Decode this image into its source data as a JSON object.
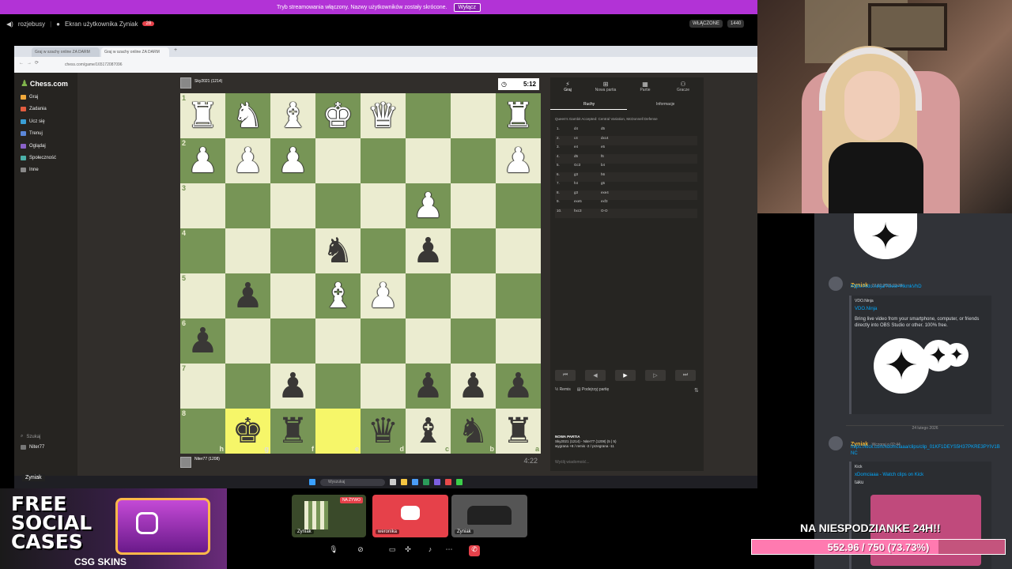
{
  "banner": {
    "text": "Tryb streamowania włączony. Nazwy użytkowników zostały skrócone.",
    "button": "Wyłącz"
  },
  "discord_header": {
    "channel": "rozjebusy",
    "screen_label": "Ekran użytkownika Zyniak",
    "live_badge": "WŁĄCZONE",
    "viewers": "1440"
  },
  "browser": {
    "tabs": [
      "Graj w szachy online ZA DARM",
      "Graj w szachy online ZA DARM"
    ],
    "url": "chess.com/game/165172087096"
  },
  "chess_sidebar": {
    "logo": "Chess.com",
    "items": [
      "Graj",
      "Zadania",
      "Ucz się",
      "Trenuj",
      "Oglądaj",
      "Społeczność",
      "Inne"
    ],
    "search": "Szukaj",
    "user": "Niter77"
  },
  "players": {
    "top": {
      "name": "Sky2021 (1214)",
      "clock": "5:12"
    },
    "bottom": {
      "name": "Niter77 (1208)",
      "clock": "4:22"
    }
  },
  "board": {
    "ranks": [
      "1",
      "2",
      "3",
      "4",
      "5",
      "6",
      "7",
      "8"
    ],
    "files": [
      "h",
      "g",
      "f",
      "e",
      "d",
      "c",
      "b",
      "a"
    ],
    "pieces": [
      [
        "wR",
        "wN",
        "wB",
        "wK",
        "wQ",
        "",
        "",
        "wR"
      ],
      [
        "wP",
        "wP",
        "wP",
        "",
        "",
        "",
        "",
        "wP"
      ],
      [
        "",
        "",
        "",
        "",
        "",
        "wP",
        "",
        ""
      ],
      [
        "",
        "",
        "",
        "bN",
        "",
        "bP",
        "",
        ""
      ],
      [
        "",
        "bP",
        "",
        "wB",
        "wP",
        "",
        "",
        ""
      ],
      [
        "bP",
        "",
        "",
        "",
        "",
        "",
        "",
        ""
      ],
      [
        "",
        "",
        "bP",
        "",
        "",
        "bP",
        "bP",
        "bP"
      ],
      [
        "",
        "bK",
        "bR",
        "",
        "bQ",
        "bB",
        "bN",
        "bR"
      ]
    ],
    "highlights": [
      [
        7,
        1
      ],
      [
        7,
        3
      ]
    ]
  },
  "right_panel": {
    "tabs": [
      "Graj",
      "Nowa partia",
      "Partie",
      "Gracze"
    ],
    "subtabs": [
      "Ruchy",
      "Informacje"
    ],
    "opening": "Queen's Gambit Accepted: Central Variation, McDonnell Defense",
    "moves": [
      [
        "1.",
        "d4",
        "d5"
      ],
      [
        "2.",
        "c4",
        "dxc4"
      ],
      [
        "3.",
        "e4",
        "e5"
      ],
      [
        "4.",
        "d5",
        "f6"
      ],
      [
        "5.",
        "Gc3",
        "b4"
      ],
      [
        "6.",
        "g3",
        "h6"
      ],
      [
        "7.",
        "h4",
        "g5"
      ],
      [
        "8.",
        "g3",
        "exe4"
      ],
      [
        "9.",
        "exe5",
        "exf3"
      ],
      [
        "10.",
        "hxc3",
        "O-O"
      ]
    ],
    "actions": [
      "Remis",
      "Podejrzyj partię"
    ],
    "new_game_title": "NOWA PARTIA",
    "new_game_line1": "Sky2021 (1214) - Niter77 (1208) (5 | 5)",
    "new_game_line2": "wygrana +8 / remis -2 / przegrana -11",
    "chat_placeholder": "Wyślij wiadomość..."
  },
  "taskbar": {
    "search": "Wyszukaj",
    "time": "00:00"
  },
  "chat": {
    "msg1": {
      "user": "Zyniak",
      "time": "22.02.2026 23:38",
      "link": "https://vdo.ninja/?view=HkmkVhD",
      "embed_site": "VDO.Ninja",
      "embed_title": "VDO.Ninja",
      "embed_desc": "Bring live video from your smartphone, computer, or friends directly into OBS Studio or other. 100% free."
    },
    "date_sep": "24 lutego 2026",
    "msg2": {
      "user": "Zyniak",
      "time": "Wczoraj o 02:44",
      "link": "https://kick.com/xdomciaaa/clips/clip_01KF1DEYS5H37PKRE3PYIV1BNC",
      "embed_site": "Kick",
      "embed_title": "xDomciaaa - Watch clips on Kick",
      "embed_desc": "taku"
    }
  },
  "ad": {
    "line1": "FREE",
    "line2": "SOCIAL",
    "line3": "CASES",
    "brand": "CSG SKINS"
  },
  "stream_tiles": [
    {
      "label": "Zyniak",
      "badge": "NA ŻYWO"
    },
    {
      "label": "weronika"
    },
    {
      "label": "Zyniak"
    }
  ],
  "goal": {
    "title": "NA NIESPODZIANKE 24H!!",
    "current": 552.96,
    "target": 750,
    "label": "552.96 / 750 (73.73%)",
    "fill_pct": 73.73
  },
  "colors": {
    "light_sq": "#ebecd0",
    "dark_sq": "#779556",
    "banner": "#b233d6",
    "goal": "#ff7ab0"
  }
}
